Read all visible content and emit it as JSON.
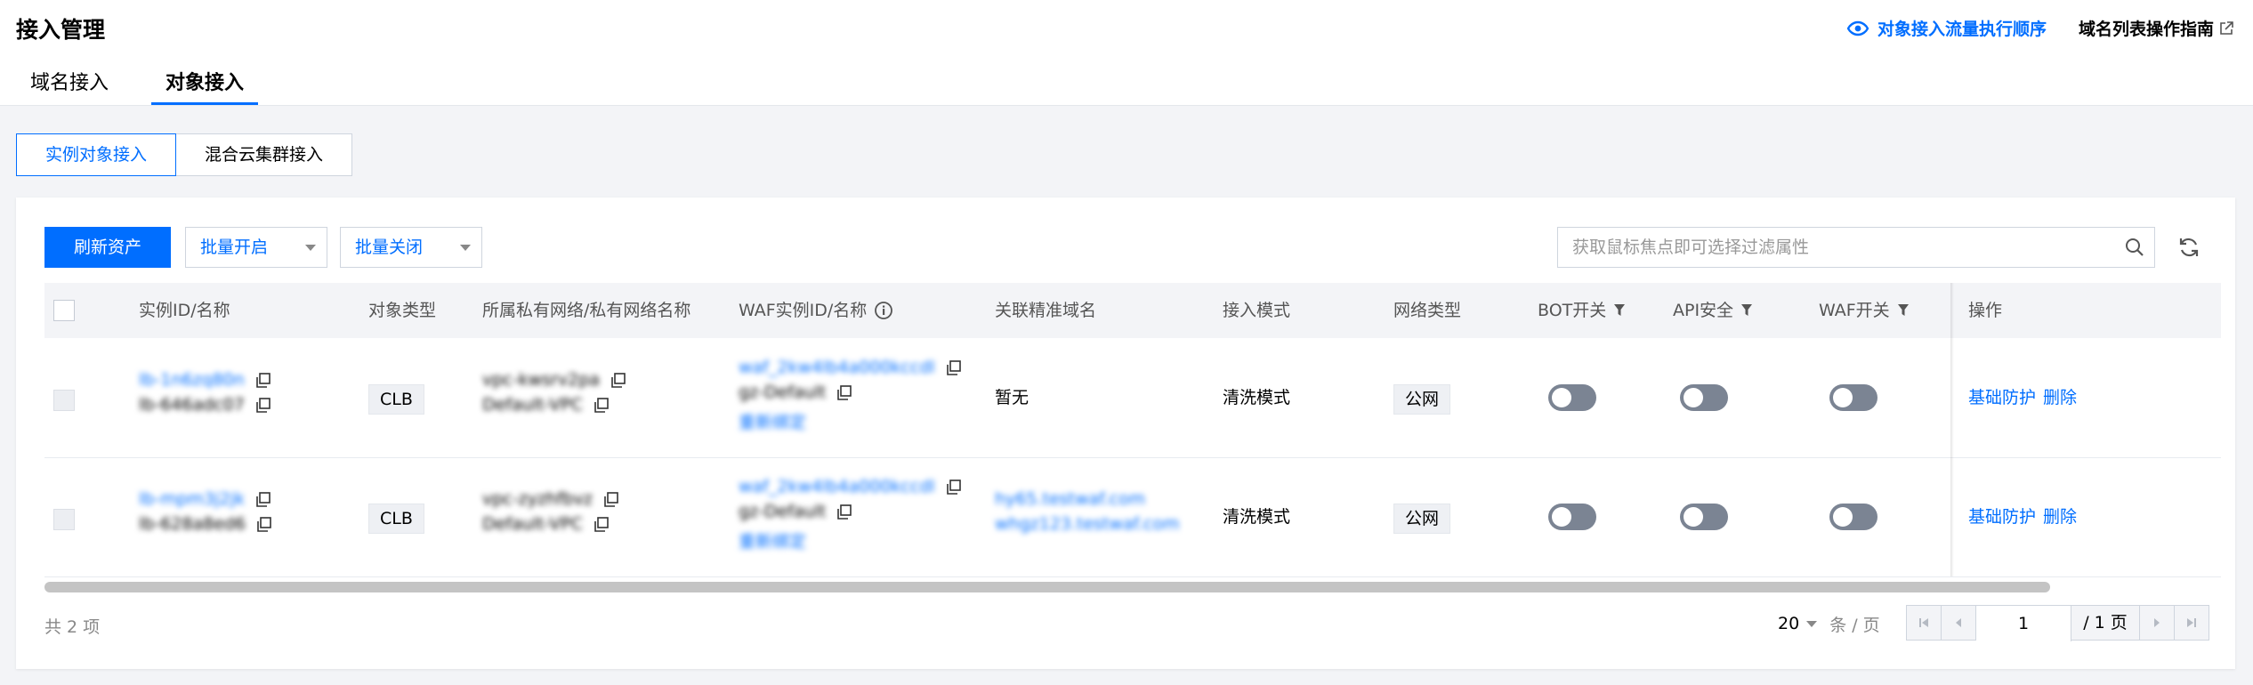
{
  "header": {
    "title": "接入管理",
    "flow_link": "对象接入流量执行顺序",
    "guide_link": "域名列表操作指南"
  },
  "tabs": [
    {
      "label": "域名接入",
      "active": false
    },
    {
      "label": "对象接入",
      "active": true
    }
  ],
  "segments": [
    {
      "label": "实例对象接入",
      "active": true
    },
    {
      "label": "混合云集群接入",
      "active": false
    }
  ],
  "toolbar": {
    "refresh_label": "刷新资产",
    "batch_on_label": "批量开启",
    "batch_off_label": "批量关闭",
    "search_placeholder": "获取鼠标焦点即可选择过滤属性"
  },
  "columns": {
    "instance": "实例ID/名称",
    "type": "对象类型",
    "vpc": "所属私有网络/私有网络名称",
    "waf": "WAF实例ID/名称",
    "domain": "关联精准域名",
    "mode": "接入模式",
    "net": "网络类型",
    "bot": "BOT开关",
    "api": "API安全",
    "wafsw": "WAF开关",
    "ops": "操作"
  },
  "rows": [
    {
      "instance_id": "lb-1n6zq80n",
      "instance_name": "lb-646adc07",
      "type": "CLB",
      "vpc_id": "vpc-kwsrv2pa",
      "vpc_name": "Default-VPC",
      "waf_id": "waf_2kw4lb4a000kccdl",
      "waf_name": "gz-Default",
      "waf_rebind": "重新绑定",
      "domains": [
        "暂无"
      ],
      "mode": "清洗模式",
      "net": "公网",
      "bot": false,
      "api": false,
      "waf": false,
      "op1": "基础防护",
      "op2": "删除"
    },
    {
      "instance_id": "lb-mpm3j2jk",
      "instance_name": "lb-628a8ed6",
      "type": "CLB",
      "vpc_id": "vpc-zyzhfbvz",
      "vpc_name": "Default-VPC",
      "waf_id": "waf_2kw4lb4a000kccdl",
      "waf_name": "gz-Default",
      "waf_rebind": "重新绑定",
      "domains": [
        "hy65.testwaf.com",
        "whgz123.testwaf.com"
      ],
      "mode": "清洗模式",
      "net": "公网",
      "bot": false,
      "api": false,
      "waf": false,
      "op1": "基础防护",
      "op2": "删除"
    }
  ],
  "footer": {
    "total": "共 2 项",
    "page_size": "20",
    "per_page": "条 / 页",
    "page": "1",
    "page_total": "/ 1 页"
  },
  "colors": {
    "primary": "#006eff",
    "switch_off": "#7b8493"
  }
}
